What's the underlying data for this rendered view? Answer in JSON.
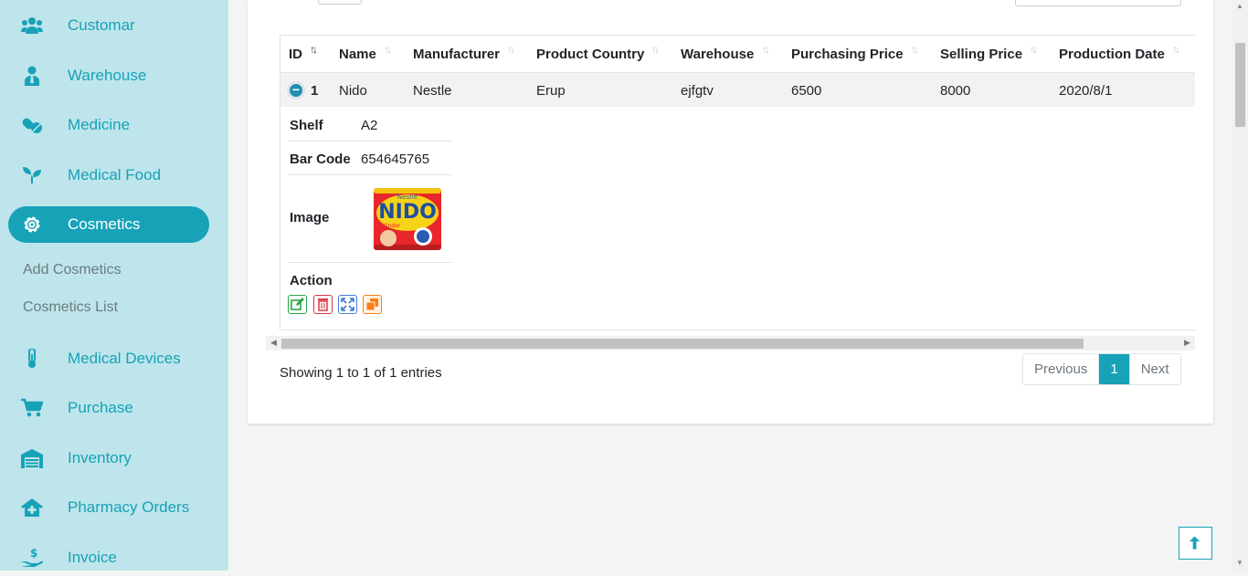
{
  "sidebar": {
    "items": [
      {
        "label": "Customar",
        "icon": "users-icon"
      },
      {
        "label": "Warehouse",
        "icon": "user-tie-icon"
      },
      {
        "label": "Medicine",
        "icon": "pills-icon"
      },
      {
        "label": "Medical Food",
        "icon": "seedling-icon"
      },
      {
        "label": "Cosmetics",
        "icon": "gear-icon",
        "active": true
      },
      {
        "label": "Medical Devices",
        "icon": "thermometer-icon"
      },
      {
        "label": "Purchase",
        "icon": "cart-icon"
      },
      {
        "label": "Inventory",
        "icon": "warehouse-icon"
      },
      {
        "label": "Pharmacy Orders",
        "icon": "clinic-icon"
      },
      {
        "label": "Invoice",
        "icon": "hand-dollar-icon"
      }
    ],
    "sub_items": [
      "Add Cosmetics",
      "Cosmetics List"
    ]
  },
  "table": {
    "columns": [
      "ID",
      "Name",
      "Manufacturer",
      "Product Country",
      "Warehouse",
      "Purchasing Price",
      "Selling Price",
      "Production Date"
    ],
    "rows": [
      {
        "id": "1",
        "name": "Nido",
        "manufacturer": "Nestle",
        "country": "Erup",
        "warehouse": "ejfgtv",
        "purchasing_price": "6500",
        "selling_price": "8000",
        "production_date": "2020/8/1"
      }
    ],
    "detail": {
      "shelf_label": "Shelf",
      "shelf_value": "A2",
      "barcode_label": "Bar Code",
      "barcode_value": "654645765",
      "image_label": "Image",
      "image_brand": "Nestlé",
      "image_title": "NIDO",
      "image_sub": "Kinder",
      "action_label": "Action"
    }
  },
  "footer": {
    "info": "Showing 1 to 1 of 1 entries",
    "prev": "Previous",
    "page": "1",
    "next": "Next"
  },
  "colors": {
    "sidebar_bg": "#bee5eb",
    "accent": "#17a2b8",
    "edit": "#28a745",
    "delete": "#dc3545",
    "expand": "#4a7fd4",
    "copy": "#fd7e14"
  }
}
